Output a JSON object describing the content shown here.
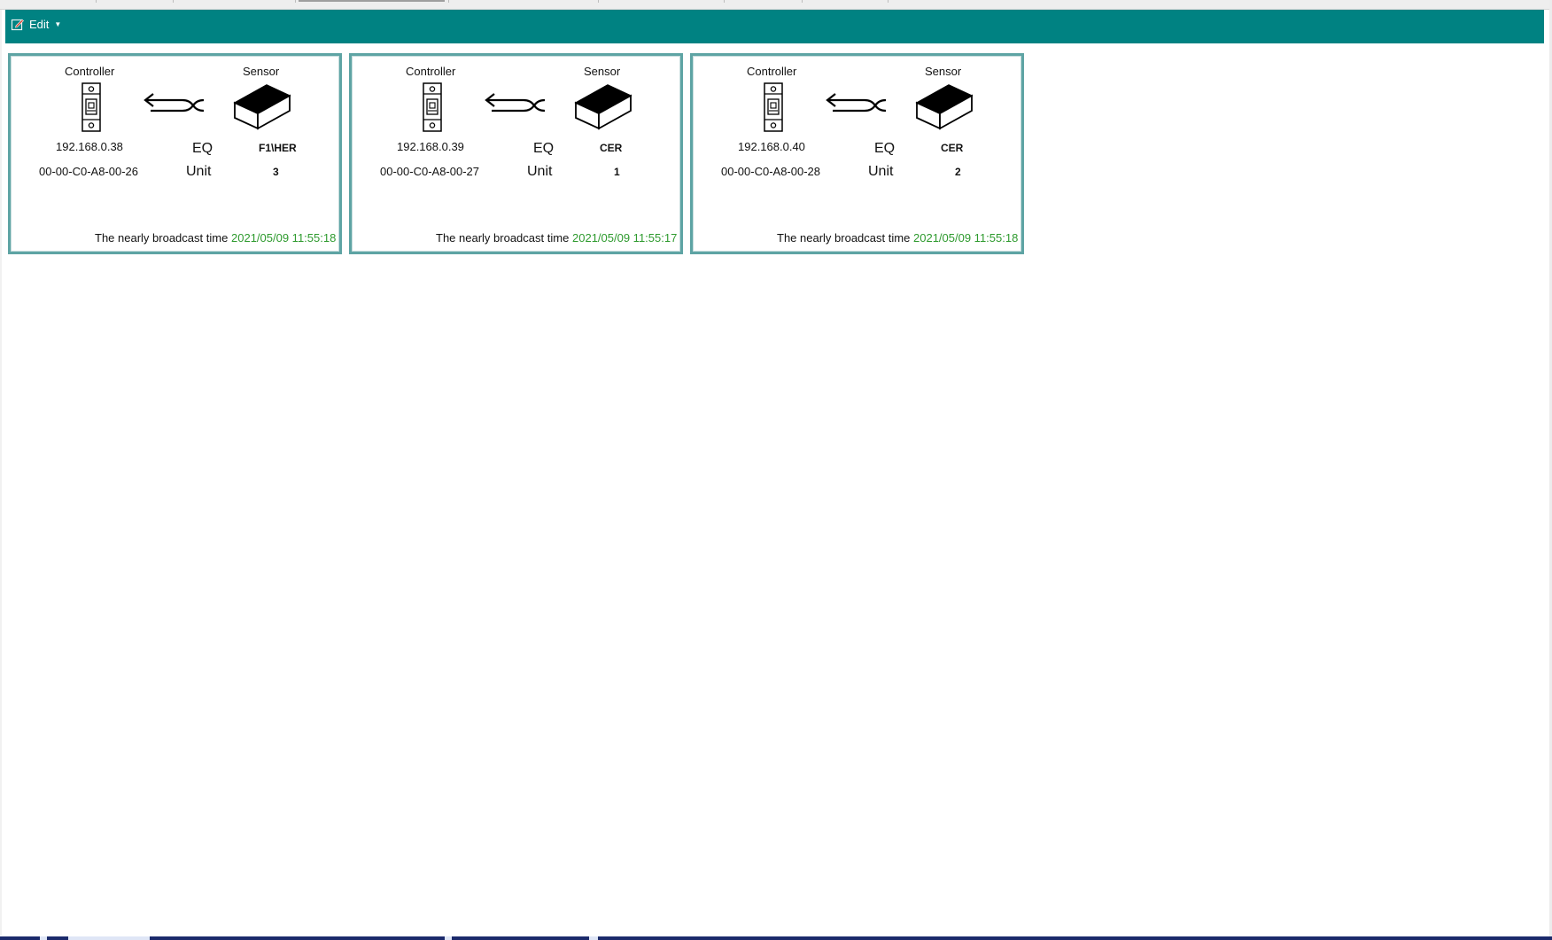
{
  "toolbar": {
    "edit_label": "Edit",
    "background_color": "#008282",
    "edit_icon": "edit-icon"
  },
  "cards": [
    {
      "controller_label": "Controller",
      "sensor_label": "Sensor",
      "ip": "192.168.0.38",
      "mac": "00-00-C0-A8-00-26",
      "eq_label": "EQ",
      "eq_value": "F1\\HER",
      "unit_label": "Unit",
      "unit_value": "3",
      "broadcast_label": "The nearly broadcast time",
      "broadcast_time": "2021/05/09 11:55:18"
    },
    {
      "controller_label": "Controller",
      "sensor_label": "Sensor",
      "ip": "192.168.0.39",
      "mac": "00-00-C0-A8-00-27",
      "eq_label": "EQ",
      "eq_value": "CER",
      "unit_label": "Unit",
      "unit_value": "1",
      "broadcast_label": "The nearly broadcast time",
      "broadcast_time": "2021/05/09 11:55:17"
    },
    {
      "controller_label": "Controller",
      "sensor_label": "Sensor",
      "ip": "192.168.0.40",
      "mac": "00-00-C0-A8-00-28",
      "eq_label": "EQ",
      "eq_value": "CER",
      "unit_label": "Unit",
      "unit_value": "2",
      "broadcast_label": "The nearly broadcast time",
      "broadcast_time": "2021/05/09 11:55:18"
    }
  ],
  "colors": {
    "card_border": "#5ea4a4",
    "broadcast_time": "#2e9a2e"
  },
  "icons": [
    "controller-device-icon",
    "signal-arrow-icon",
    "sensor-box-icon"
  ]
}
